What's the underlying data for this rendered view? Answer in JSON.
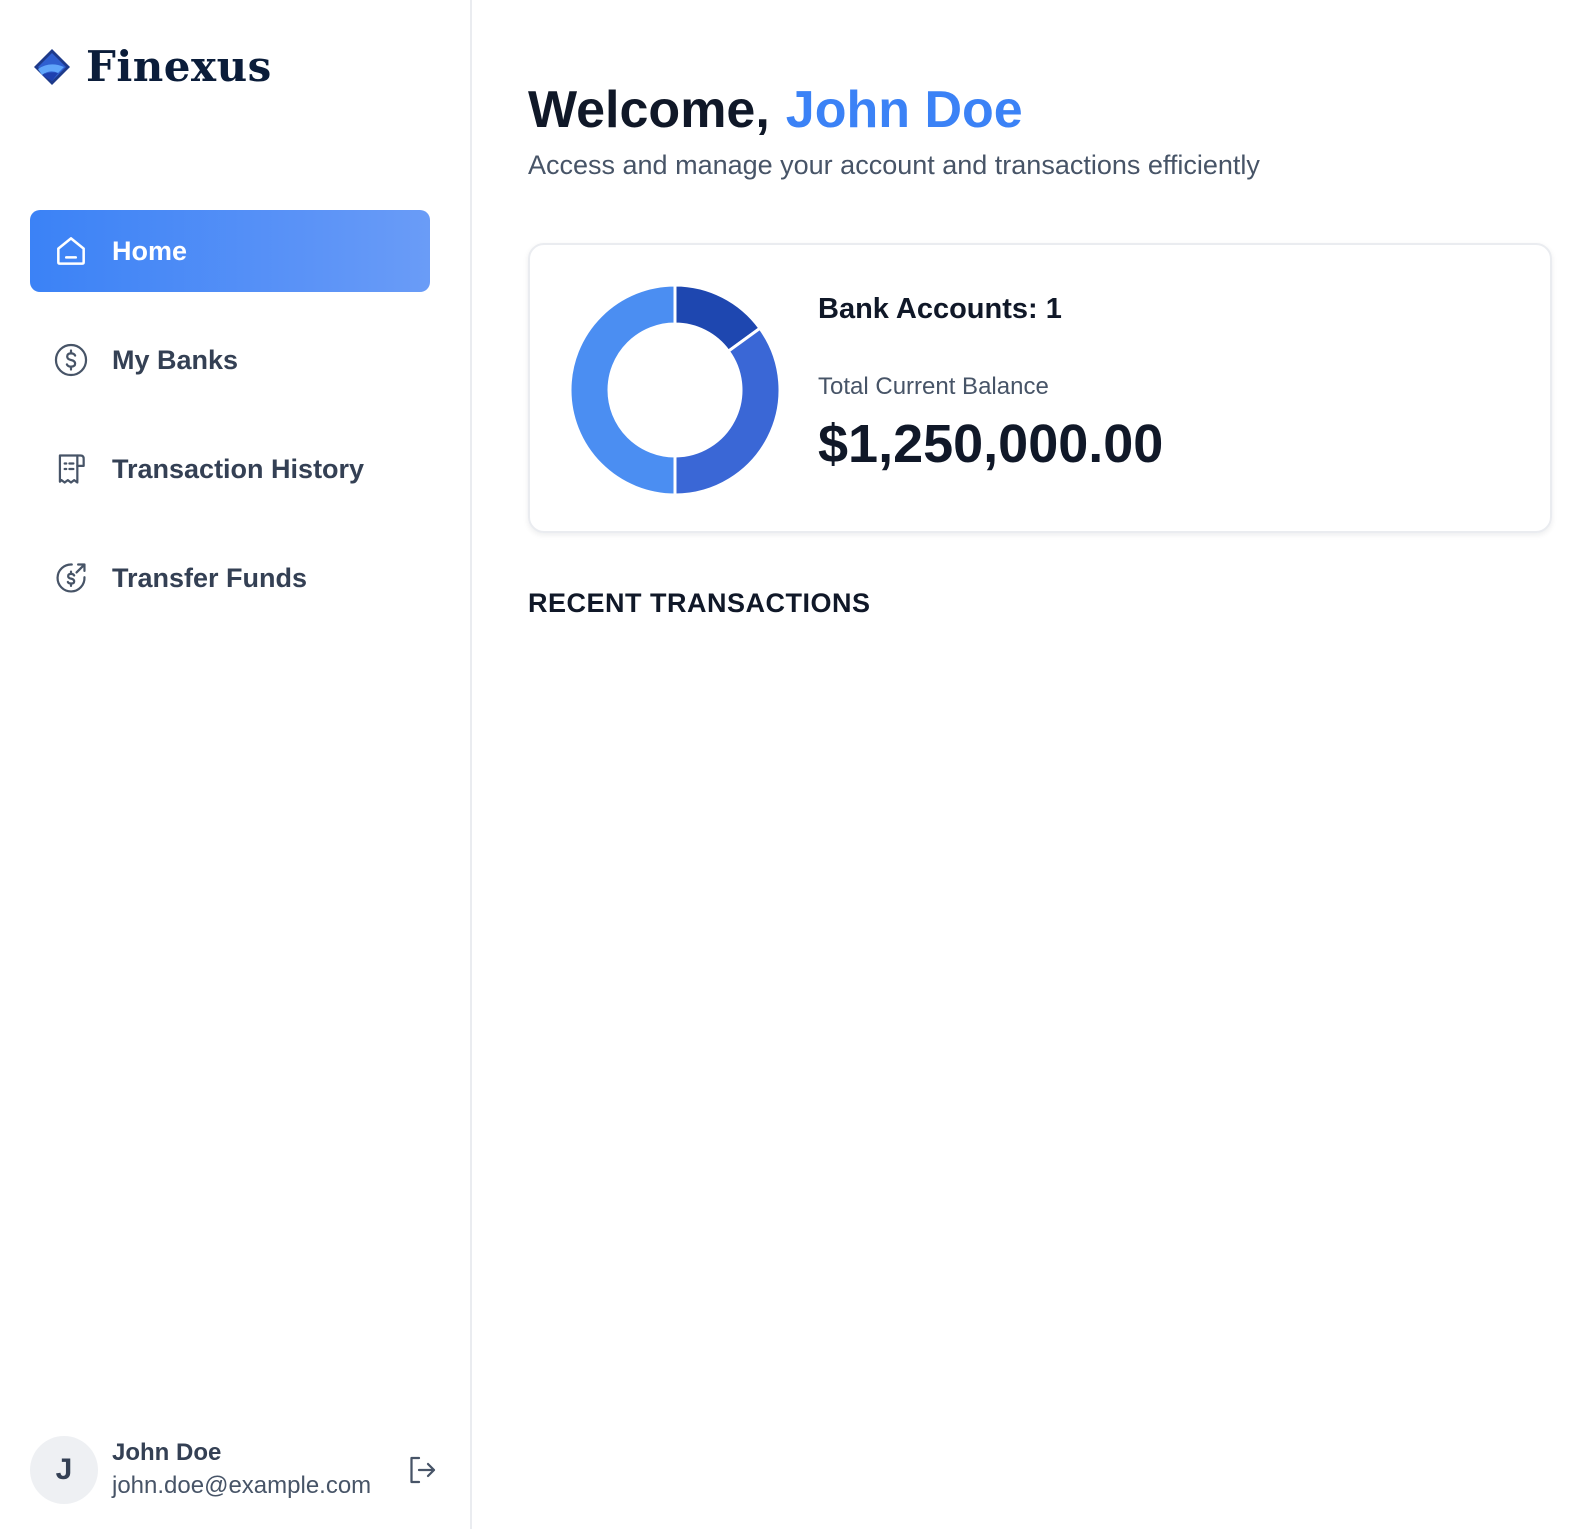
{
  "brand": {
    "name": "Finexus",
    "icon": "finexus-logo-icon"
  },
  "sidebar": {
    "items": [
      {
        "label": "Home",
        "icon": "home-icon",
        "active": true
      },
      {
        "label": "My Banks",
        "icon": "dollar-circle-icon",
        "active": false
      },
      {
        "label": "Transaction History",
        "icon": "receipt-icon",
        "active": false
      },
      {
        "label": "Transfer Funds",
        "icon": "money-send-icon",
        "active": false
      }
    ],
    "accent_color": "#3b82f6"
  },
  "user": {
    "initial": "J",
    "name": "John Doe",
    "email": "john.doe@example.com",
    "logout_icon": "logout-icon"
  },
  "header": {
    "welcome_prefix": "Welcome,",
    "welcome_name": "John Doe",
    "subtitle": "Access and manage your account and transactions efficiently"
  },
  "balance": {
    "accounts_label": "Bank Accounts: 1",
    "total_label": "Total Current Balance",
    "total_value": "$1,250,000.00"
  },
  "chart_data": {
    "type": "pie",
    "donut": true,
    "series": [
      {
        "value": 15,
        "color": "#1e47b0"
      },
      {
        "value": 35,
        "color": "#3a67d6"
      },
      {
        "value": 50,
        "color": "#4b8ef2"
      }
    ]
  },
  "recent": {
    "title": "RECENT TRANSACTIONS"
  }
}
